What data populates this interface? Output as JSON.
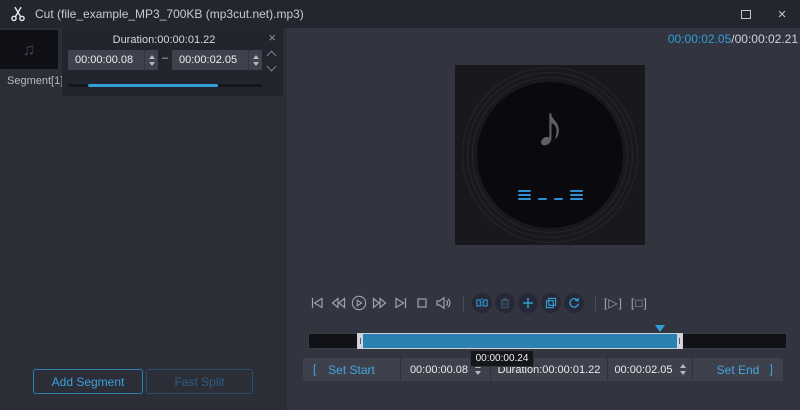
{
  "window": {
    "title": "Cut (file_example_MP3_700KB (mp3cut.net).mp3)",
    "close_glyph": "×"
  },
  "segments": {
    "item_label": "Segment[1]",
    "thumb_note_glyph": "♫",
    "card": {
      "duration": "Duration:00:00:01.22",
      "start": "00:00:00.08",
      "dash": "–",
      "end": "00:00:02.05",
      "close_glyph": "×"
    },
    "add_segment": "Add Segment",
    "fast_split": "Fast Split"
  },
  "player": {
    "art_note_glyph": "♪",
    "play_clip": "[▷]",
    "stop_clip": "[□]",
    "time_current": "00:00:02.05",
    "time_total": "/00:00:02.21",
    "tooltip": "00:00:00.24"
  },
  "cut_bar": {
    "bracket_left": "[",
    "set_start": "Set Start",
    "start": "00:00:00.08",
    "duration": "Duration:00:00:01.22",
    "end": "00:00:02.05",
    "set_end": "Set End",
    "bracket_right": "]"
  },
  "colors": {
    "accent_blue": "#2f9fd8",
    "selection_fill": "#2b80b2",
    "panel_dark": "#2b2d37",
    "panel_light": "#32343f"
  }
}
